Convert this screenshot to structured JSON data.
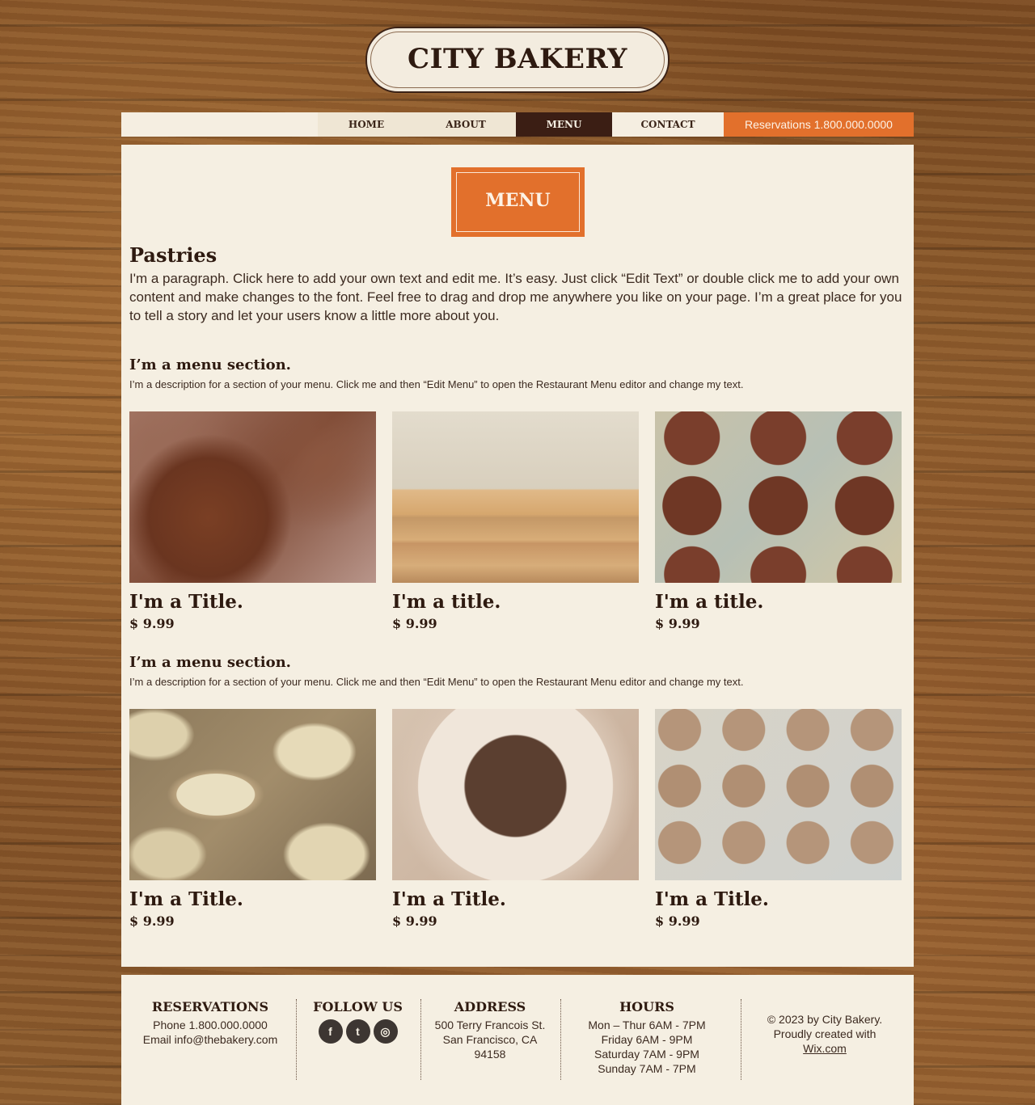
{
  "brand": {
    "logo_text": "CITY BAKERY"
  },
  "nav": {
    "items": [
      {
        "label": "HOME"
      },
      {
        "label": "ABOUT"
      },
      {
        "label": "MENU",
        "active": true
      },
      {
        "label": "CONTACT"
      }
    ],
    "reservations_label": "Reservations 1.800.000.0000"
  },
  "page": {
    "badge": "MENU",
    "heading": "Pastries",
    "intro": "I'm a paragraph. Click here to add your own text and edit me. It’s easy. Just click “Edit Text” or double click me to add your own content and make changes to the font. Feel free to drag and drop me anywhere you like on your page. I’m a great place for you to tell a story and let your users know a little more about you."
  },
  "sections": [
    {
      "title": "I’m a menu section.",
      "description": "I’m a description for a section of your menu. Click me and then “Edit Menu” to open the Restaurant Menu editor and change my text.",
      "items": [
        {
          "title": "I'm a Title.",
          "price": "$ 9.99"
        },
        {
          "title": "I'm a title.",
          "price": "$ 9.99"
        },
        {
          "title": "I'm a title.",
          "price": "$ 9.99"
        }
      ]
    },
    {
      "title": "I’m a menu section.",
      "description": "I’m a description for a section of your menu. Click me and then “Edit Menu” to open the Restaurant Menu editor and change my text.",
      "items": [
        {
          "title": "I'm a Title.",
          "price": "$ 9.99"
        },
        {
          "title": "I'm a Title.",
          "price": "$ 9.99"
        },
        {
          "title": "I'm a Title.",
          "price": "$ 9.99"
        }
      ]
    }
  ],
  "footer": {
    "reservations": {
      "heading": "RESERVATIONS",
      "phone": "Phone 1.800.000.0000",
      "email": "Email info@thebakery.com"
    },
    "follow": {
      "heading": "FOLLOW US",
      "icons": [
        "facebook-icon",
        "twitter-icon",
        "instagram-icon"
      ]
    },
    "address": {
      "heading": "ADDRESS",
      "line1": "500 Terry Francois St.",
      "line2": "San Francisco, CA",
      "line3": "94158"
    },
    "hours": {
      "heading": "HOURS",
      "line1": "Mon – Thur  6AM - 7PM",
      "line2": "Friday  6AM - 9PM",
      "line3": "Saturday  7AM - 9PM",
      "line4": "Sunday  7AM - 7PM"
    },
    "copyright": {
      "line1": "© 2023 by City Bakery.",
      "line2": "Proudly created with",
      "link": "Wix.com"
    }
  },
  "colors": {
    "accent": "#e2702c",
    "dark": "#3b1e14",
    "panel": "#f5efe2"
  }
}
